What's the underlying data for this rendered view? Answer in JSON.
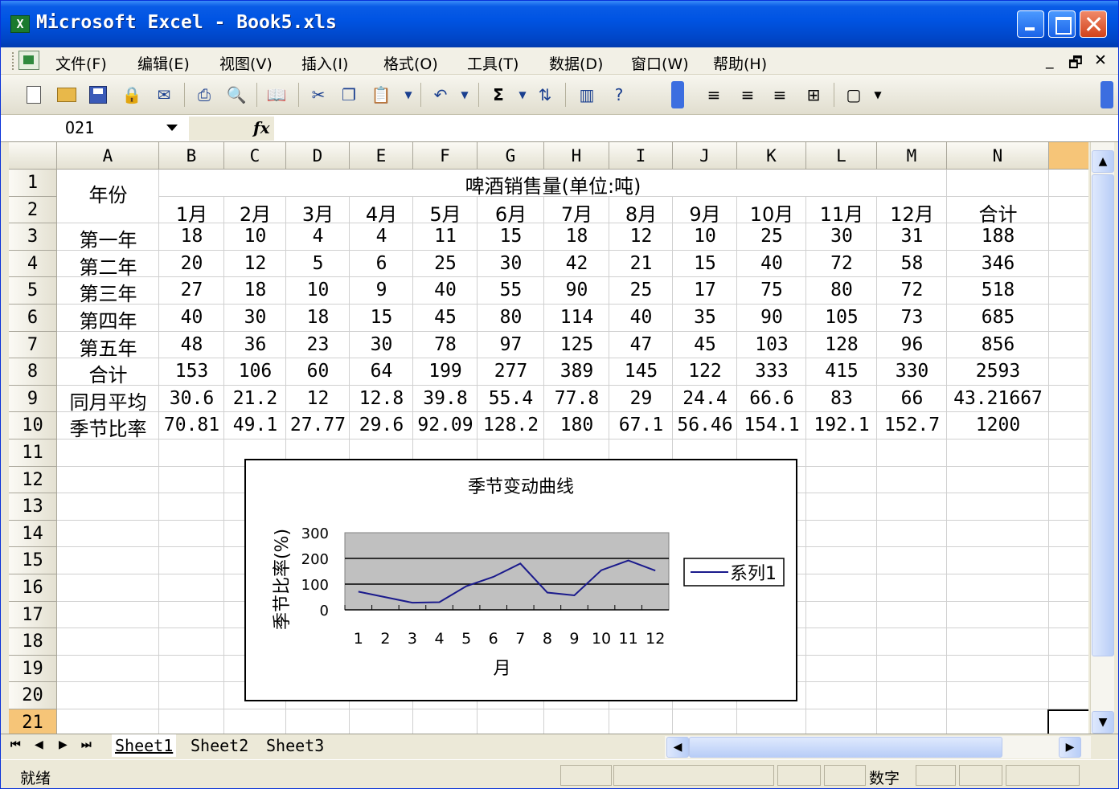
{
  "window": {
    "title": "Microsoft Excel - Book5.xls",
    "app_icon": "excel-icon"
  },
  "menu": [
    "文件(F)",
    "编辑(E)",
    "视图(V)",
    "插入(I)",
    "格式(O)",
    "工具(T)",
    "数据(D)",
    "窗口(W)",
    "帮助(H)"
  ],
  "mdi_controls": [
    "_",
    "🗗",
    "✕"
  ],
  "toolbar": {
    "autosum": "Σ",
    "icons": [
      "new-icon",
      "open-icon",
      "save-icon",
      "permission-icon",
      "email-icon",
      "print-icon",
      "print-preview-icon",
      "research-icon",
      "cut-icon",
      "copy-icon",
      "paste-icon",
      "undo-icon",
      "autosum-icon",
      "sort-ascending-icon",
      "chart-wizard-icon",
      "help-icon",
      "align-left-icon",
      "align-center-icon",
      "align-right-icon",
      "merge-center-icon",
      "borders-icon"
    ]
  },
  "formula_bar": {
    "name_box": "O21",
    "fx": "fx",
    "formula": ""
  },
  "sheet": {
    "columns": [
      "A",
      "B",
      "C",
      "D",
      "E",
      "F",
      "G",
      "H",
      "I",
      "J",
      "K",
      "L",
      "M",
      "N"
    ],
    "rows": [
      "1",
      "2",
      "3",
      "4",
      "5",
      "6",
      "7",
      "8",
      "9",
      "10",
      "11",
      "12",
      "13",
      "14",
      "15",
      "16",
      "17",
      "18",
      "19",
      "20",
      "21"
    ],
    "a1": "年份",
    "header_title": "啤酒销售量(单位:吨)",
    "months": [
      "1月",
      "2月",
      "3月",
      "4月",
      "5月",
      "6月",
      "7月",
      "8月",
      "9月",
      "10月",
      "11月",
      "12月",
      "合计"
    ],
    "data_rows": [
      {
        "label": "第一年",
        "values": [
          "18",
          "10",
          "4",
          "4",
          "11",
          "15",
          "18",
          "12",
          "10",
          "25",
          "30",
          "31",
          "188"
        ]
      },
      {
        "label": "第二年",
        "values": [
          "20",
          "12",
          "5",
          "6",
          "25",
          "30",
          "42",
          "21",
          "15",
          "40",
          "72",
          "58",
          "346"
        ]
      },
      {
        "label": "第三年",
        "values": [
          "27",
          "18",
          "10",
          "9",
          "40",
          "55",
          "90",
          "25",
          "17",
          "75",
          "80",
          "72",
          "518"
        ]
      },
      {
        "label": "第四年",
        "values": [
          "40",
          "30",
          "18",
          "15",
          "45",
          "80",
          "114",
          "40",
          "35",
          "90",
          "105",
          "73",
          "685"
        ]
      },
      {
        "label": "第五年",
        "values": [
          "48",
          "36",
          "23",
          "30",
          "78",
          "97",
          "125",
          "47",
          "45",
          "103",
          "128",
          "96",
          "856"
        ]
      },
      {
        "label": "合计",
        "values": [
          "153",
          "106",
          "60",
          "64",
          "199",
          "277",
          "389",
          "145",
          "122",
          "333",
          "415",
          "330",
          "2593"
        ]
      },
      {
        "label": "同月平均",
        "values": [
          "30.6",
          "21.2",
          "12",
          "12.8",
          "39.8",
          "55.4",
          "77.8",
          "29",
          "24.4",
          "66.6",
          "83",
          "66",
          "43.21667"
        ]
      },
      {
        "label": "季节比率",
        "values": [
          "70.81",
          "49.1",
          "27.77",
          "29.6",
          "92.09",
          "128.2",
          "180",
          "67.1",
          "56.46",
          "154.1",
          "192.1",
          "152.7",
          "1200"
        ]
      }
    ]
  },
  "chart_data": {
    "type": "line",
    "title": "季节变动曲线",
    "xlabel": "月",
    "ylabel": "季节比率(%)",
    "x": [
      "1",
      "2",
      "3",
      "4",
      "5",
      "6",
      "7",
      "8",
      "9",
      "10",
      "11",
      "12"
    ],
    "yticks": [
      "0",
      "100",
      "200",
      "300"
    ],
    "ylim": [
      0,
      300
    ],
    "grid": true,
    "legend_position": "right",
    "series": [
      {
        "name": "系列1",
        "values": [
          70.81,
          49.1,
          27.77,
          29.6,
          92.09,
          128.2,
          180,
          67.1,
          56.46,
          154.1,
          192.1,
          152.7
        ],
        "color": "#1a1a8c"
      }
    ],
    "plot_background": "#c0c0c0"
  },
  "sheet_tabs": {
    "tabs": [
      "Sheet1",
      "Sheet2",
      "Sheet3"
    ],
    "active": "Sheet1",
    "nav": [
      "⏮",
      "◀",
      "▶",
      "⏭"
    ]
  },
  "status": {
    "ready": "就绪",
    "mode": "数字"
  },
  "colors": {
    "title_bar": "#0054e3",
    "selected_header": "#f6c578",
    "chart_line": "#1a1a8c"
  }
}
